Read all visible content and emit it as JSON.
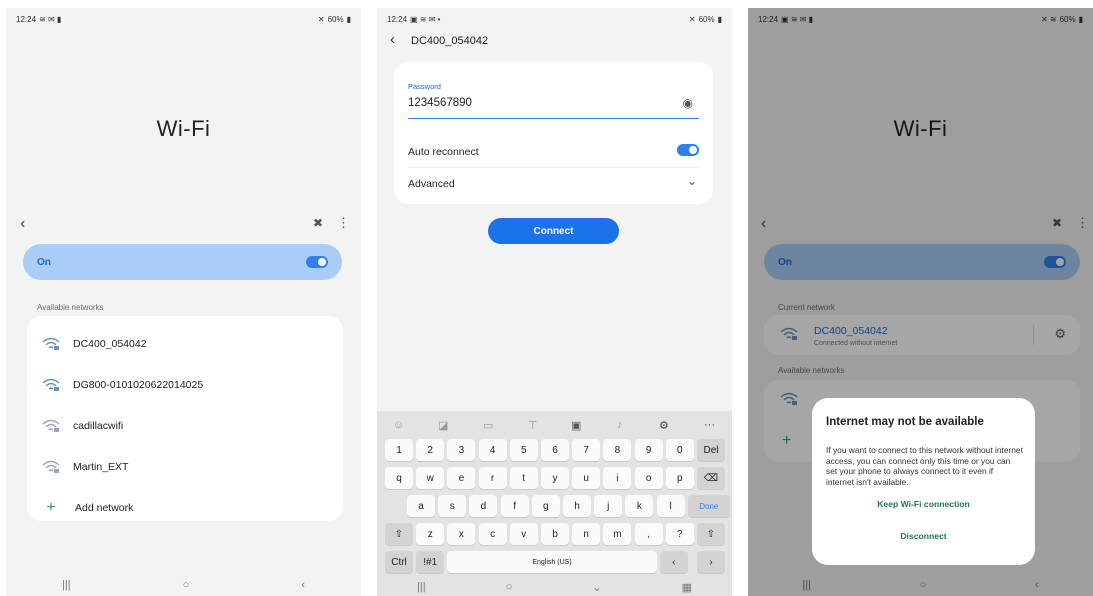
{
  "status": {
    "time": "12:24",
    "battery": "60%"
  },
  "wifi_list_screen": {
    "title": "Wi-Fi",
    "toggle_label": "On",
    "section_available": "Available networks",
    "networks": [
      {
        "name": "DC400_054042"
      },
      {
        "name": "DG800-0101020622014025"
      },
      {
        "name": "cadillacwifi"
      },
      {
        "name": "Martin_EXT"
      }
    ],
    "add_network": "Add network"
  },
  "password_screen": {
    "network_name": "DC400_054042",
    "password_label": "Password",
    "password_value": "1234567890",
    "auto_reconnect": "Auto reconnect",
    "advanced": "Advanced",
    "connect": "Connect",
    "keyboard": {
      "row_numbers": [
        "1",
        "2",
        "3",
        "4",
        "5",
        "6",
        "7",
        "8",
        "9",
        "0"
      ],
      "del": "Del",
      "row_q": [
        "q",
        "w",
        "e",
        "r",
        "t",
        "y",
        "u",
        "i",
        "o",
        "p"
      ],
      "row_a": [
        "a",
        "s",
        "d",
        "f",
        "g",
        "h",
        "j",
        "k",
        "l"
      ],
      "done": "Done",
      "row_z": [
        "z",
        "x",
        "c",
        "v",
        "b",
        "n",
        "m",
        ",",
        "."
      ],
      "ctrl": "Ctrl",
      "sym": "!#1",
      "space": "English (US)"
    }
  },
  "dialog_screen": {
    "title": "Wi-Fi",
    "toggle_label": "On",
    "section_current": "Current network",
    "current_network": "DC400_054042",
    "current_status": "Connected without internet",
    "section_available": "Available networks",
    "dialog": {
      "title": "Internet may not be available",
      "body": "If you want to connect to this network without internet access, you can connect only this time or you can set your phone to always connect to it even if internet isn't available.",
      "keep": "Keep Wi-Fi connection",
      "disconnect": "Disconnect"
    }
  },
  "colors": {
    "accent": "#2f80ea",
    "toggle_bar": "#a9cdf6",
    "dialog_action": "#1f7a4f"
  }
}
